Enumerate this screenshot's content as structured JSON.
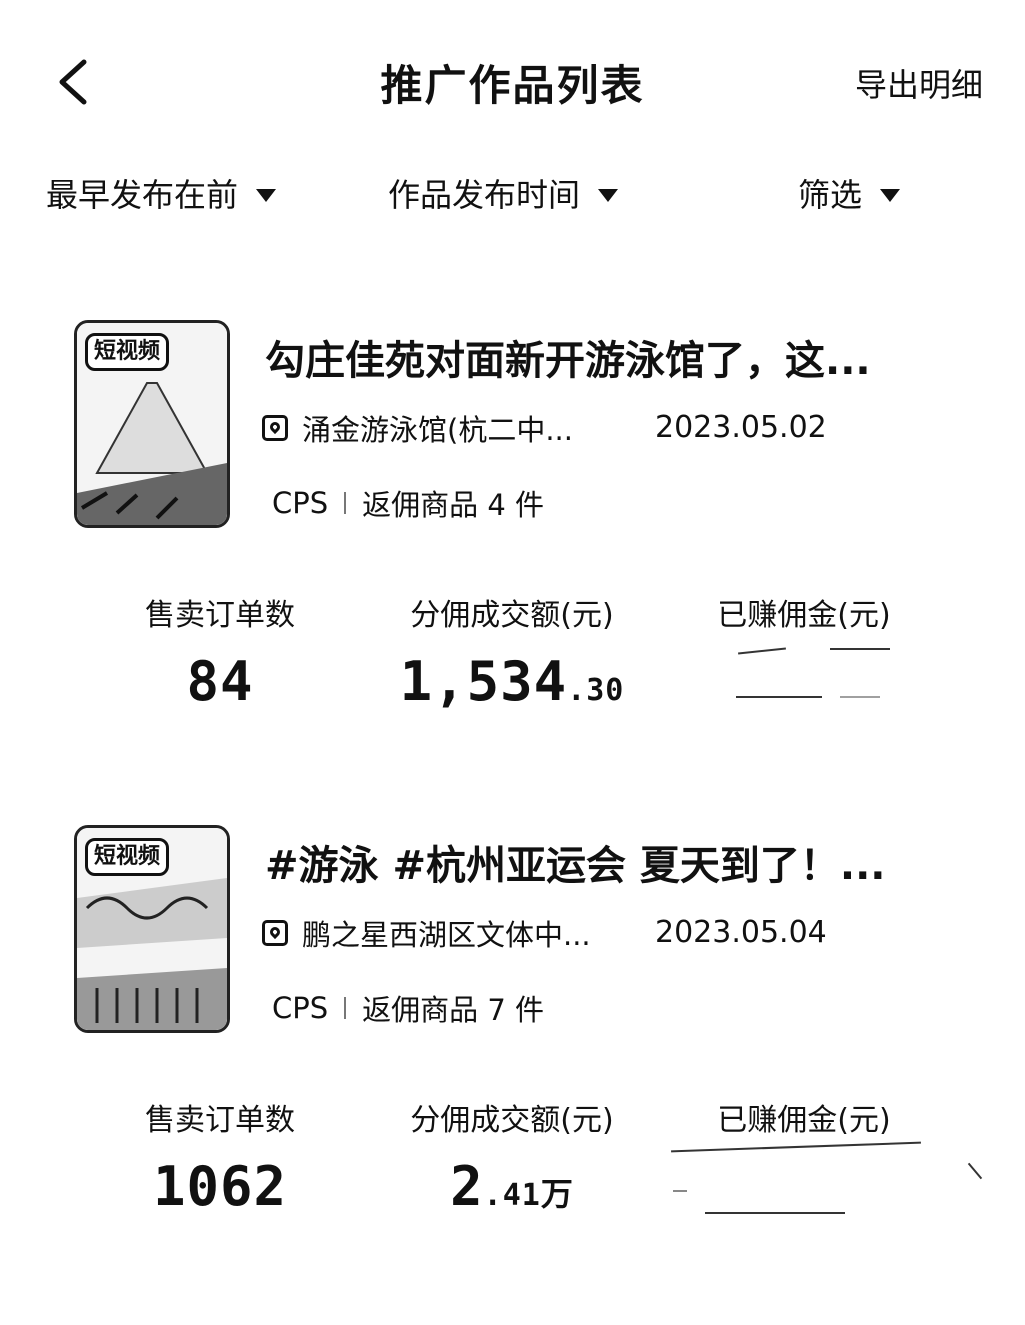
{
  "header": {
    "title": "推广作品列表",
    "export_label": "导出明细"
  },
  "filters": {
    "sort_label": "最早发布在前",
    "time_label": "作品发布时间",
    "filter_label": "筛选"
  },
  "works": [
    {
      "badge": "短视频",
      "title": "勾庄佳苑对面新开游泳馆了，这...",
      "location": "涌金游泳馆(杭二中...",
      "date": "2023.05.02",
      "type": "CPS",
      "goods": "返佣商品 4 件",
      "orders_label": "售卖订单数",
      "orders": "84",
      "gmv_label": "分佣成交额(元)",
      "gmv_main": "1,534",
      "gmv_tail": ".30",
      "gmv_unit": "",
      "earned_label": "已赚佣金(元)"
    },
    {
      "badge": "短视频",
      "title": "#游泳 #杭州亚运会 夏天到了！...",
      "location": "鹏之星西湖区文体中...",
      "date": "2023.05.04",
      "type": "CPS",
      "goods": "返佣商品 7 件",
      "orders_label": "售卖订单数",
      "orders": "1062",
      "gmv_label": "分佣成交额(元)",
      "gmv_main": "2",
      "gmv_tail": ".41",
      "gmv_unit": "万",
      "earned_label": "已赚佣金(元)"
    }
  ]
}
